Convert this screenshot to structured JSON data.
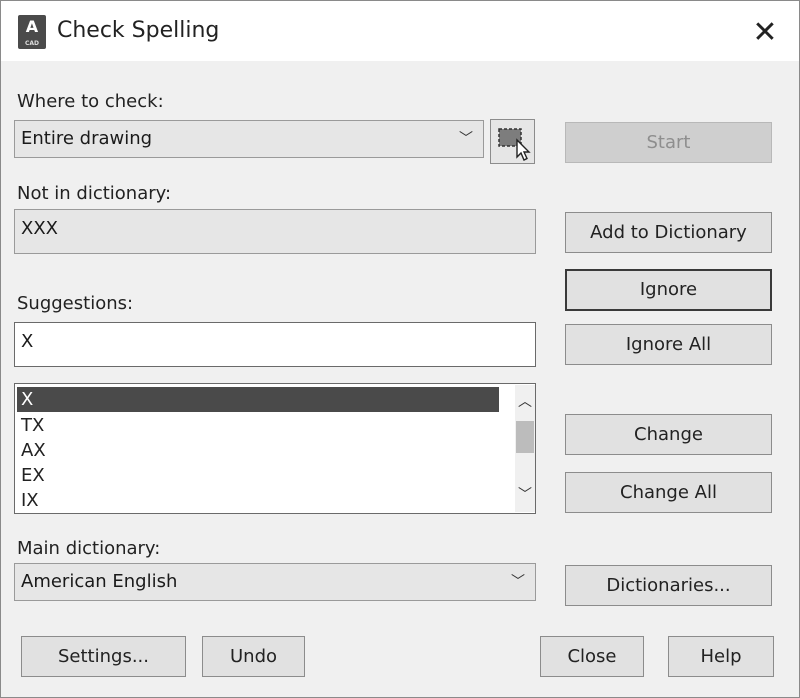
{
  "window": {
    "title": "Check Spelling",
    "app_icon_letter": "A",
    "app_icon_sub": "CAD",
    "close_glyph": "✕"
  },
  "where_to_check": {
    "label": "Where to check:",
    "selected": "Entire drawing",
    "pick_icon": "select-objects-icon"
  },
  "not_in_dictionary": {
    "label": "Not in dictionary:",
    "value": "XXX"
  },
  "suggestions": {
    "label": "Suggestions:",
    "value": "X",
    "list": [
      "X",
      "TX",
      "AX",
      "EX",
      "IX"
    ],
    "selected_index": 0
  },
  "main_dictionary": {
    "label": "Main dictionary:",
    "selected": "American English"
  },
  "buttons": {
    "start": "Start",
    "add_to_dictionary": "Add to Dictionary",
    "ignore": "Ignore",
    "ignore_all": "Ignore All",
    "change": "Change",
    "change_all": "Change All",
    "dictionaries": "Dictionaries...",
    "settings": "Settings...",
    "undo": "Undo",
    "close": "Close",
    "help": "Help"
  },
  "icons": {
    "chevron_down": "﹀",
    "scroll_up": "︿",
    "scroll_down": "﹀"
  }
}
